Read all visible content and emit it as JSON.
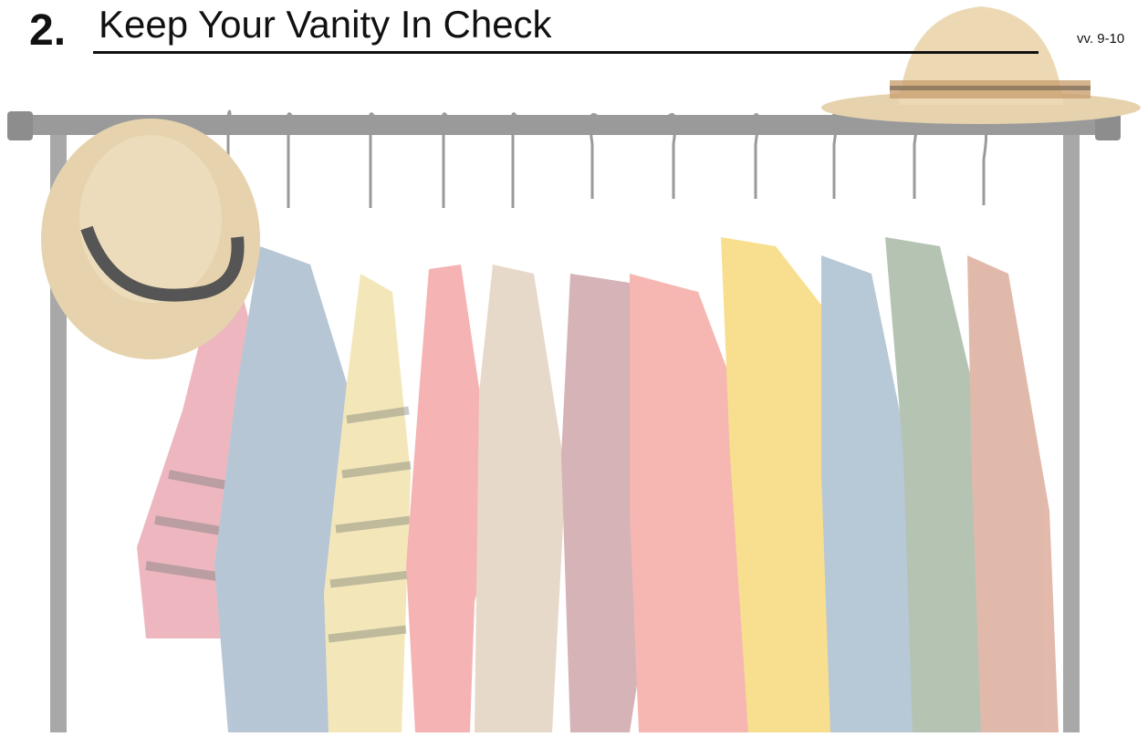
{
  "heading": {
    "number": "2.",
    "title": "Keep Your Vanity In Check",
    "verses": "vv. 9-10"
  },
  "illustration": {
    "subject": "clothing rack with hanging garments and two straw hats",
    "garment_colors": [
      "#e9a0aa",
      "#9fb4c8",
      "#efe0a4",
      "#f29a9a",
      "#dfcdb8",
      "#c99aa0",
      "#f3a09a",
      "#f6d56a",
      "#9fb6c9",
      "#9db09a",
      "#d8a28f"
    ],
    "hat_color": "#e6d3ad"
  }
}
